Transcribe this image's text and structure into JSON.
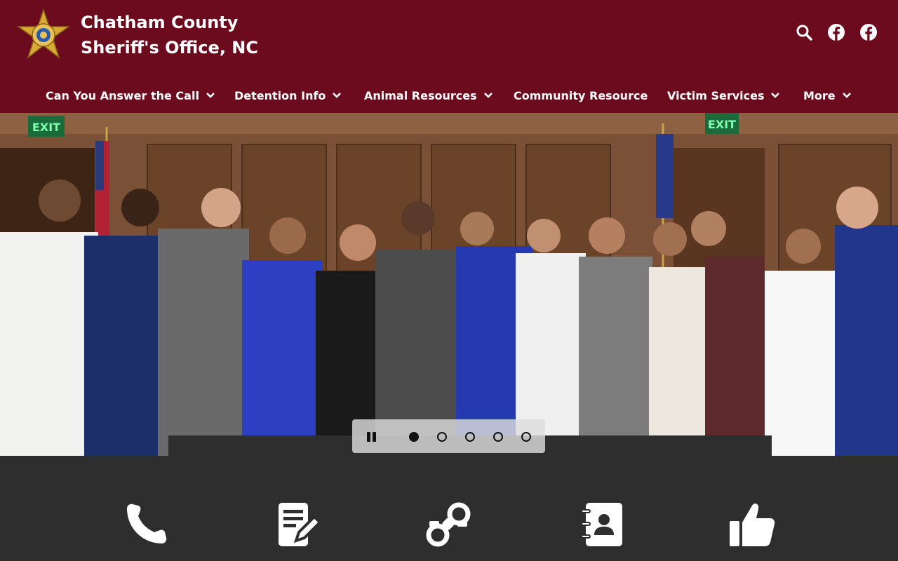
{
  "header": {
    "title_line1": "Chatham County",
    "title_line2": "Sheriff's Office, NC",
    "logo_icon": "sheriff-star-badge",
    "brand_color": "#6c0a1e",
    "icons": [
      "search-icon",
      "facebook-icon",
      "facebook-icon"
    ]
  },
  "nav": {
    "items": [
      {
        "label": "Can You Answer the Call",
        "has_dropdown": true
      },
      {
        "label": "Detention Info",
        "has_dropdown": true
      },
      {
        "label": "Animal Resources",
        "has_dropdown": true
      },
      {
        "label": "Community Resource",
        "has_dropdown": false
      },
      {
        "label": "Victim Services",
        "has_dropdown": true
      },
      {
        "label": "More",
        "has_dropdown": true
      }
    ]
  },
  "hero": {
    "slides_count": 5,
    "active_slide": 1,
    "exit_sign_1": "EXIT",
    "exit_sign_2": "EXIT"
  },
  "quick_links": {
    "icons": [
      "phone-icon",
      "form-icon",
      "handcuffs-icon",
      "contacts-icon",
      "thumbs-up-icon"
    ]
  }
}
